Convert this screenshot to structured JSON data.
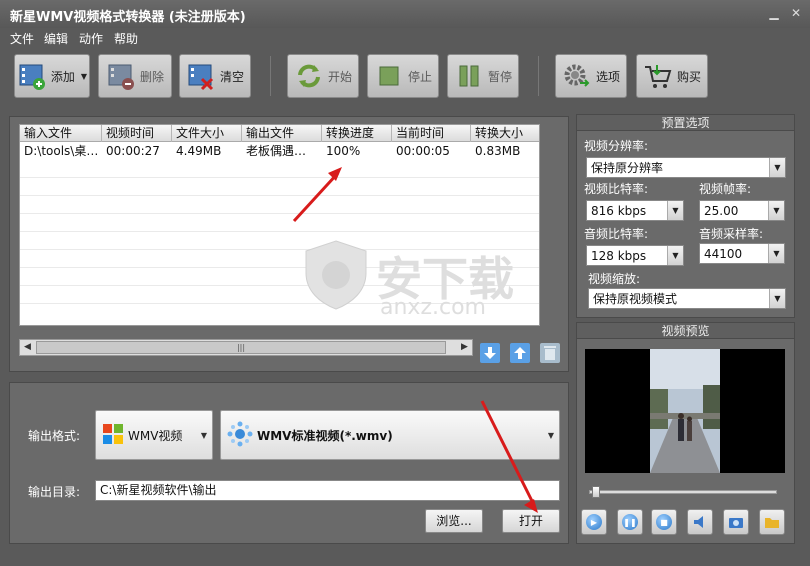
{
  "window": {
    "title": "新星WMV视频格式转换器 (未注册版本)"
  },
  "menu": [
    "文件",
    "编辑",
    "动作",
    "帮助"
  ],
  "toolbar": {
    "add": "添加",
    "delete": "删除",
    "clear": "清空",
    "start": "开始",
    "stop": "停止",
    "pause": "暂停",
    "options": "选项",
    "buy": "购买"
  },
  "table": {
    "columns": [
      "输入文件",
      "视频时间",
      "文件大小",
      "输出文件",
      "转换进度",
      "当前时间",
      "转换大小"
    ],
    "rows": [
      [
        "D:\\tools\\桌…",
        "00:00:27",
        "4.49MB",
        "老板偶遇…",
        "100%",
        "00:00:05",
        "0.83MB"
      ]
    ]
  },
  "output": {
    "format_label": "输出格式:",
    "format_value": "WMV视频",
    "profile_value": "WMV标准视频(*.wmv)",
    "dir_label": "输出目录:",
    "dir_value": "C:\\新星视频软件\\输出",
    "browse": "浏览...",
    "open": "打开"
  },
  "preset": {
    "title": "预置选项",
    "resolution_label": "视频分辨率:",
    "resolution_value": "保持原分辨率",
    "vbitrate_label": "视频比特率:",
    "vbitrate_value": "816 kbps",
    "fps_label": "视频帧率:",
    "fps_value": "25.00",
    "abitrate_label": "音频比特率:",
    "abitrate_value": "128 kbps",
    "samplerate_label": "音频采样率:",
    "samplerate_value": "44100",
    "scale_label": "视频缩放:",
    "scale_value": "保持原视频模式"
  },
  "preview": {
    "title": "视频预览"
  },
  "watermark": {
    "text": "安下载",
    "url": "anxz.com"
  }
}
